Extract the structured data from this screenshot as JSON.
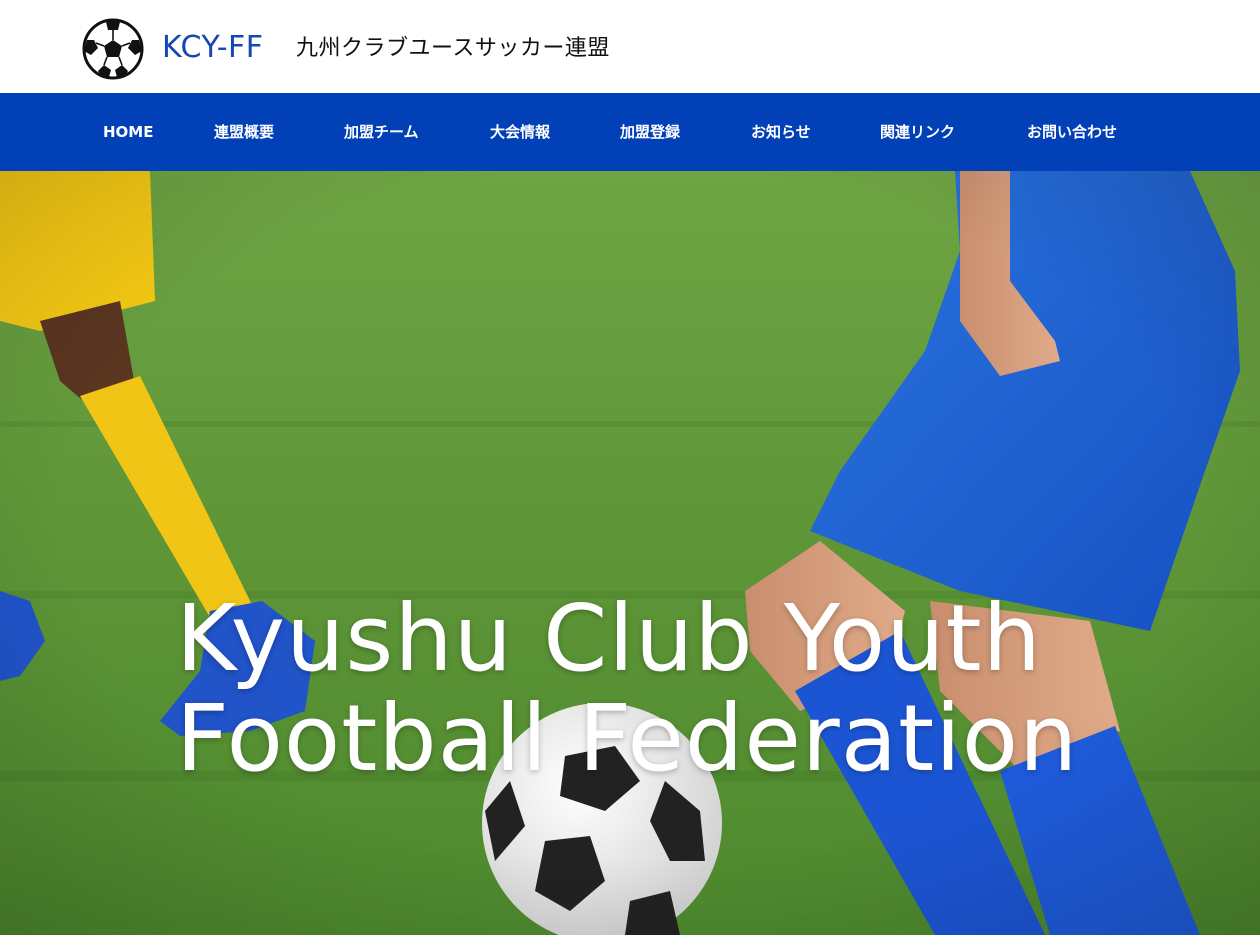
{
  "header": {
    "logo_abbr": "KCY-FF",
    "logo_name": "九州クラブユースサッカー連盟"
  },
  "nav": {
    "items": [
      {
        "label": "HOME"
      },
      {
        "label": "連盟概要"
      },
      {
        "label": "加盟チーム"
      },
      {
        "label": "大会情報"
      },
      {
        "label": "加盟登録"
      },
      {
        "label": "お知らせ"
      },
      {
        "label": "関連リンク"
      },
      {
        "label": "お問い合わせ"
      }
    ]
  },
  "hero": {
    "title_line1": "Kyushu Club Youth",
    "title_line2": "Football Federation",
    "image_subject": "football-players-on-grass-photo"
  },
  "colors": {
    "brand_blue": "#1646b4",
    "nav_background": "#0240b8",
    "grass_green": "#5f9a3a",
    "jersey_blue": "#1e5fd1",
    "jersey_yellow": "#f3c814"
  }
}
